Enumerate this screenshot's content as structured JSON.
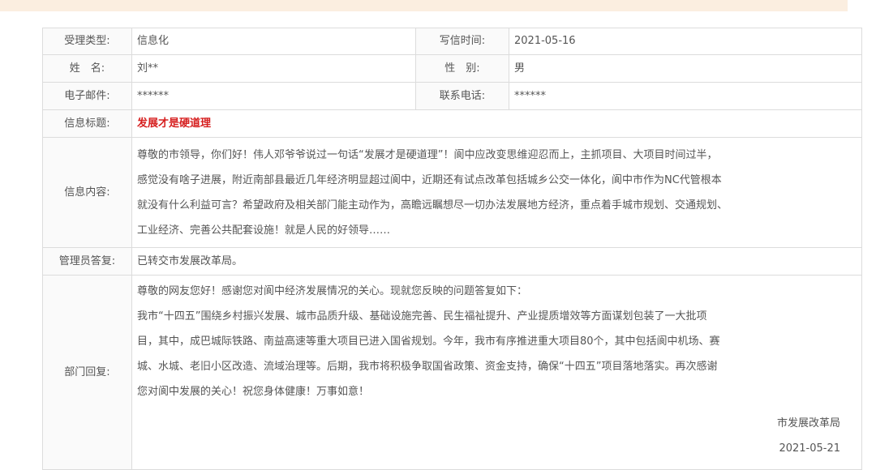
{
  "fields": {
    "type_label": "受理类型:",
    "type_value": "信息化",
    "date_label": "写信时间:",
    "date_value": "2021-05-16",
    "name_label": "姓　名:",
    "name_value": "刘**",
    "gender_label": "性　别:",
    "gender_value": "男",
    "email_label": "电子邮件:",
    "email_value": "******",
    "phone_label": "联系电话:",
    "phone_value": "******",
    "title_label": "信息标题:",
    "title_value": "发展才是硬道理",
    "content_label": "信息内容:",
    "content_lines": [
      "尊敬的市领导，你们好！伟人邓爷爷说过一句话“发展才是硬道理”！阆中应改变思维迎忍而上，主抓项目、大项目时间过半，",
      "感觉没有啥子进展，附近南部县最近几年经济明显超过阆中，近期还有试点改革包括城乡公交一体化，阆中市作为NC代管根本",
      "就没有什么利益可言？希望政府及相关部门能主动作为，高瞻远瞩想尽一切办法发展地方经济，重点着手城市规划、交通规划、",
      "工业经济、完善公共配套设施！就是人民的好领导……"
    ],
    "admin_label": "管理员答复:",
    "admin_value": "已转交市发展改革局。",
    "dept_label": "部门回复:",
    "dept_lines": [
      "尊敬的网友您好！感谢您对阆中经济发展情况的关心。现就您反映的问题答复如下：",
      "我市“十四五”围绕乡村振兴发展、城市品质升级、基础设施完善、民生福祉提升、产业提质增效等方面谋划包装了一大批项",
      "目，其中，成巴城际铁路、南益高速等重大项目已进入国省规划。今年，我市有序推进重大项目80个，其中包括阆中机场、赛",
      "城、水城、老旧小区改造、流域治理等。后期，我市将积极争取国省政策、资金支持，确保“十四五”项目落地落实。再次感谢",
      "您对阆中发展的关心！祝您身体健康！万事如意！"
    ],
    "dept_sign": "市发展改革局",
    "dept_date": "2021-05-21"
  }
}
